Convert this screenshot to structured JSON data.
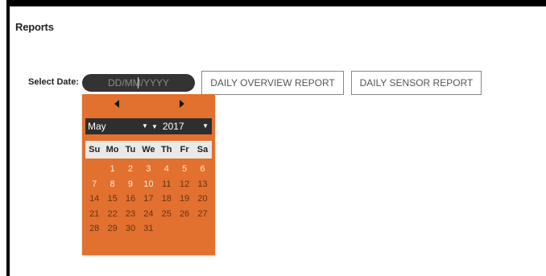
{
  "page": {
    "title": "Reports"
  },
  "filter": {
    "label": "Select Date:",
    "date_placeholder": "DD/MM/YYYY"
  },
  "buttons": {
    "overview": "DAILY OVERVIEW REPORT",
    "sensor": "DAILY SENSOR REPORT"
  },
  "calendar": {
    "month": "May",
    "year": "2017",
    "weekdays": [
      "Su",
      "Mo",
      "Tu",
      "We",
      "Th",
      "Fr",
      "Sa"
    ],
    "first_weekday_offset": 1,
    "days": [
      "1",
      "2",
      "3",
      "4",
      "5",
      "6",
      "7",
      "8",
      "9",
      "10",
      "11",
      "12",
      "13",
      "14",
      "15",
      "16",
      "17",
      "18",
      "19",
      "20",
      "21",
      "22",
      "23",
      "24",
      "25",
      "26",
      "27",
      "28",
      "29",
      "30",
      "31"
    ],
    "highlighted_days": [
      "1",
      "2",
      "3",
      "4",
      "5",
      "6",
      "7",
      "8",
      "9",
      "10"
    ],
    "colors": {
      "background": "#e2702e",
      "selects": "#2e2e2e",
      "weekday_bar": "#e9e9e9"
    }
  },
  "icons": {
    "prev": "triangle-left-icon",
    "next": "triangle-right-icon"
  }
}
